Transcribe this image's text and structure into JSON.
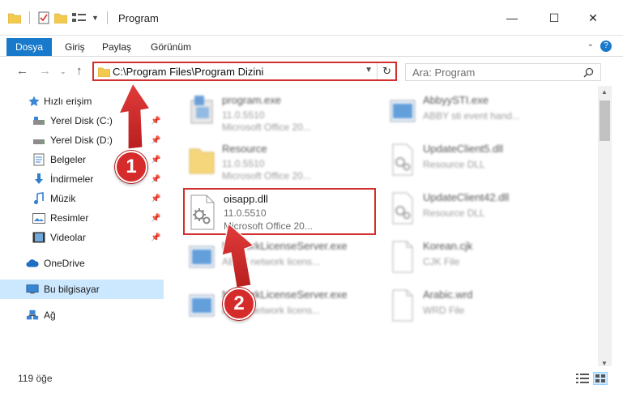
{
  "window": {
    "title": "Program",
    "minimize": "—",
    "maximize": "☐",
    "close": "✕"
  },
  "ribbon": {
    "tabs": [
      {
        "label": "Dosya",
        "active": true
      },
      {
        "label": "Giriş"
      },
      {
        "label": "Paylaş"
      },
      {
        "label": "Görünüm"
      }
    ],
    "help": "?"
  },
  "address": {
    "path": "C:\\Program Files\\Program Dizini",
    "search_placeholder": "Ara: Program"
  },
  "sidebar": {
    "items": [
      {
        "label": "Hızlı erişim",
        "icon": "star-icon"
      },
      {
        "label": "Yerel Disk (C:)",
        "icon": "drive-icon",
        "pinned": true
      },
      {
        "label": "Yerel Disk (D:)",
        "icon": "drive-icon",
        "pinned": true
      },
      {
        "label": "Belgeler",
        "icon": "documents-icon",
        "pinned": true
      },
      {
        "label": "İndirmeler",
        "icon": "download-icon",
        "pinned": true
      },
      {
        "label": "Müzik",
        "icon": "music-icon",
        "pinned": true
      },
      {
        "label": "Resimler",
        "icon": "pictures-icon",
        "pinned": true
      },
      {
        "label": "Videolar",
        "icon": "video-icon",
        "pinned": true
      },
      {
        "label": "OneDrive",
        "icon": "cloud-icon"
      },
      {
        "label": "Bu bilgisayar",
        "icon": "computer-icon",
        "selected": true
      },
      {
        "label": "Ağ",
        "icon": "network-icon"
      }
    ]
  },
  "files": {
    "left": [
      {
        "name": "program.exe",
        "line1": "11.0.5510",
        "line2": "Microsoft Office 20..."
      },
      {
        "name": "Resource",
        "line1": "11.0.5510",
        "line2": "Microsoft Office 20..."
      },
      {
        "name": "oisapp.dll",
        "line1": "11.0.5510",
        "line2": "Microsoft Office 20..."
      },
      {
        "name": "NetworkLicenseServer.exe",
        "line1": "ABBY network licens..."
      },
      {
        "name": "NetworkLicenseServer.exe",
        "line1": "ABBY network licens..."
      }
    ],
    "right": [
      {
        "name": "AbbyySTI.exe",
        "line1": "ABBY sti event hand..."
      },
      {
        "name": "UpdateClient5.dll",
        "line1": "Resource DLL"
      },
      {
        "name": "UpdateClient42.dll",
        "line1": "Resource DLL"
      },
      {
        "name": "Korean.cjk",
        "line1": "CJK File"
      },
      {
        "name": "Arabic.wrd",
        "line1": "WRD File"
      }
    ]
  },
  "status": {
    "count": "119 öğe"
  },
  "annotations": {
    "step1": "1",
    "step2": "2",
    "color": "#d32f2f"
  }
}
